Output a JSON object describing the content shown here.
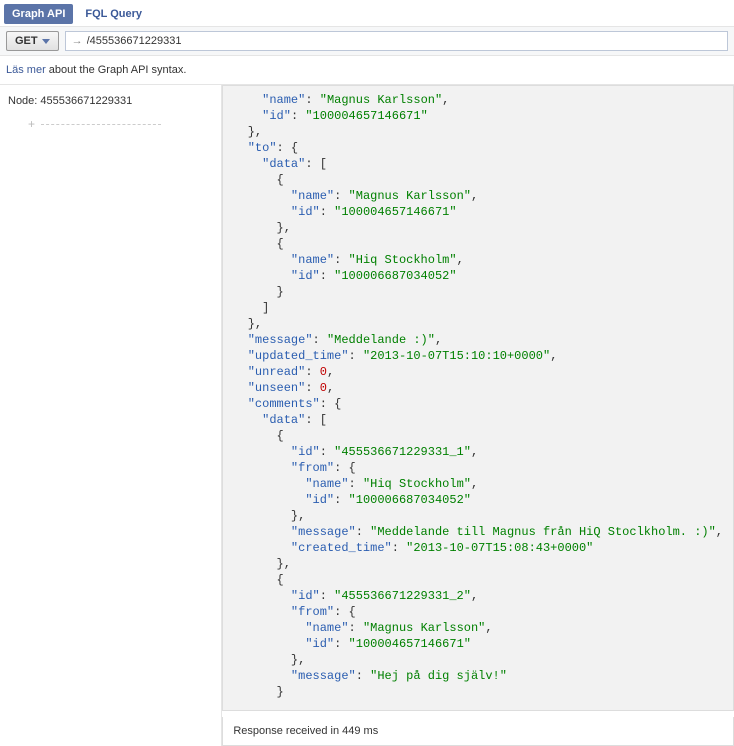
{
  "tabs": {
    "graph": "Graph API",
    "fql": "FQL Query"
  },
  "request": {
    "method": "GET",
    "arrow": "→",
    "path": "/455536671229331"
  },
  "hint": {
    "link": "Läs mer",
    "rest": " about the Graph API syntax."
  },
  "left": {
    "node_label": "Node: ",
    "node_id": "455536671229331",
    "plus": "+"
  },
  "json": {
    "from": {
      "name": "Magnus Karlsson",
      "id": "100004657146671"
    },
    "to_data": [
      {
        "name": "Magnus Karlsson",
        "id": "100004657146671"
      },
      {
        "name": "Hiq Stockholm",
        "id": "100006687034052"
      }
    ],
    "message": "Meddelande :)",
    "updated_time": "2013-10-07T15:10:10+0000",
    "unread": "0",
    "unseen": "0",
    "comments": [
      {
        "id": "455536671229331_1",
        "from": {
          "name": "Hiq Stockholm",
          "id": "100006687034052"
        },
        "message": "Meddelande till Magnus från HiQ Stoclkholm. :)",
        "created_time": "2013-10-07T15:08:43+0000"
      },
      {
        "id": "455536671229331_2",
        "from": {
          "name": "Magnus Karlsson",
          "id": "100004657146671"
        },
        "message": "Hej på dig själv!"
      }
    ]
  },
  "footer": {
    "text": "Response received in 449 ms"
  }
}
